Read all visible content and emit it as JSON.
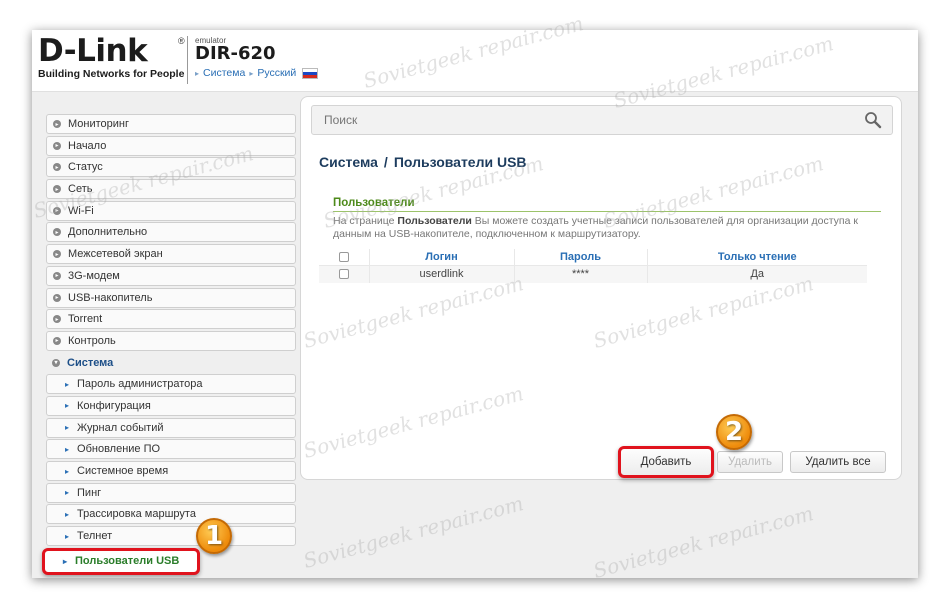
{
  "header": {
    "brand": "D-Link",
    "brand_reg": "®",
    "tagline": "Building Networks for People",
    "emulator": "emulator",
    "model": "DIR-620",
    "breadcrumb": [
      "Система",
      "Русский"
    ]
  },
  "sidebar": {
    "items": [
      {
        "label": "Мониторинг",
        "type": "top"
      },
      {
        "label": "Начало",
        "type": "top"
      },
      {
        "label": "Статус",
        "type": "top"
      },
      {
        "label": "Сеть",
        "type": "top"
      },
      {
        "label": "Wi-Fi",
        "type": "top"
      },
      {
        "label": "Дополнительно",
        "type": "top"
      },
      {
        "label": "Межсетевой экран",
        "type": "top"
      },
      {
        "label": "3G-модем",
        "type": "top"
      },
      {
        "label": "USB-накопитель",
        "type": "top"
      },
      {
        "label": "Torrent",
        "type": "top"
      },
      {
        "label": "Контроль",
        "type": "top"
      },
      {
        "label": "Система",
        "type": "open"
      },
      {
        "label": "Пароль администратора",
        "type": "sub"
      },
      {
        "label": "Конфигурация",
        "type": "sub"
      },
      {
        "label": "Журнал событий",
        "type": "sub"
      },
      {
        "label": "Обновление ПО",
        "type": "sub"
      },
      {
        "label": "Системное время",
        "type": "sub"
      },
      {
        "label": "Пинг",
        "type": "sub"
      },
      {
        "label": "Трассировка маршрута",
        "type": "sub"
      },
      {
        "label": "Телнет",
        "type": "sub"
      },
      {
        "label": "Пользователи USB",
        "type": "active"
      }
    ]
  },
  "search": {
    "placeholder": "Поиск"
  },
  "page": {
    "crumb1": "Система",
    "sep": "/",
    "crumb2": "Пользователи USB"
  },
  "section": {
    "title": "Пользователи",
    "desc_prefix": "На странице ",
    "desc_bold": "Пользователи",
    "desc_suffix": " Вы можете создать учетные записи пользователей для организации доступа к данным на USB-накопителе, подключенном к маршрутизатору."
  },
  "table": {
    "headers": [
      "Логин",
      "Пароль",
      "Только чтение"
    ],
    "rows": [
      {
        "login": "userdlink",
        "password": "****",
        "readonly": "Да"
      }
    ]
  },
  "buttons": {
    "add": "Добавить",
    "delete": "Удалить",
    "delete_all": "Удалить все"
  },
  "badges": [
    "1",
    "2"
  ],
  "watermark": "Sovietgeek repair.com",
  "colors": {
    "accent_red": "#e0131d",
    "link_blue": "#2a6fb5",
    "section_green": "#4d8a1a",
    "badge_orange": "#ee8b0b"
  }
}
